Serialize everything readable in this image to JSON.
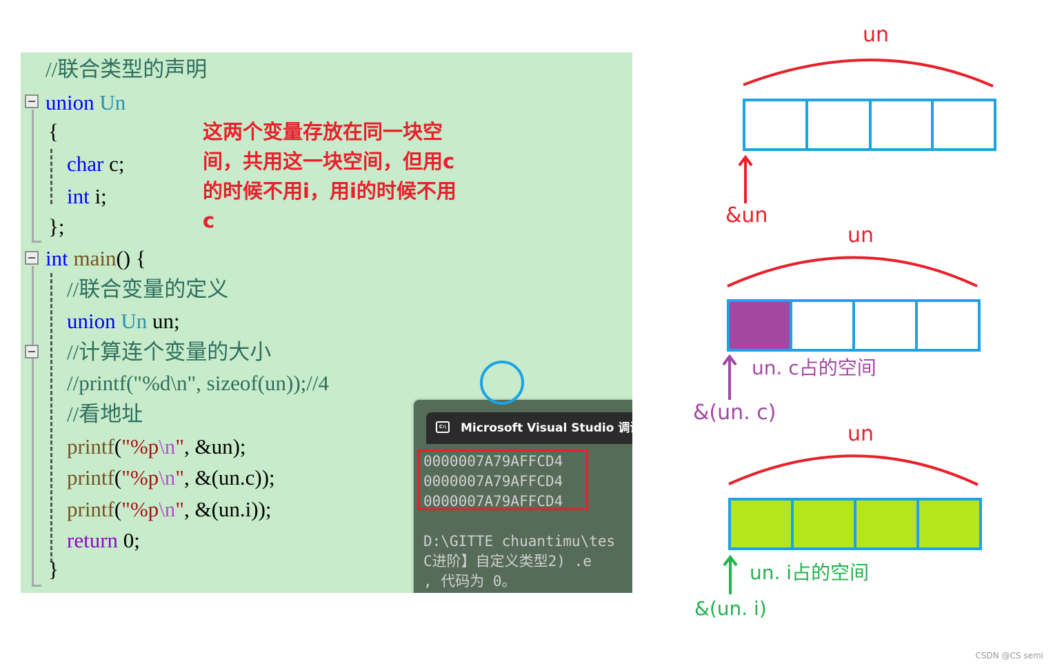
{
  "code": {
    "lines": [
      [
        {
          "k": "comment",
          "t": "//联合类型的声明"
        }
      ],
      [
        {
          "k": "kw",
          "t": "union"
        },
        {
          "k": "plain",
          "t": " "
        },
        {
          "k": "type",
          "t": "Un"
        }
      ],
      [
        {
          "k": "plain",
          "t": "{"
        }
      ],
      [
        {
          "k": "plain",
          "t": "    "
        },
        {
          "k": "kw",
          "t": "char"
        },
        {
          "k": "plain",
          "t": " c;"
        }
      ],
      [
        {
          "k": "plain",
          "t": "    "
        },
        {
          "k": "kw",
          "t": "int"
        },
        {
          "k": "plain",
          "t": " i;"
        }
      ],
      [
        {
          "k": "plain",
          "t": "};"
        }
      ],
      [
        {
          "k": "kw",
          "t": "int"
        },
        {
          "k": "plain",
          "t": " "
        },
        {
          "k": "fn",
          "t": "main"
        },
        {
          "k": "plain",
          "t": "() {"
        }
      ],
      [
        {
          "k": "plain",
          "t": "    "
        },
        {
          "k": "comment",
          "t": "//联合变量的定义"
        }
      ],
      [
        {
          "k": "plain",
          "t": "    "
        },
        {
          "k": "kw",
          "t": "union"
        },
        {
          "k": "plain",
          "t": " "
        },
        {
          "k": "type",
          "t": "Un"
        },
        {
          "k": "plain",
          "t": " un;"
        }
      ],
      [
        {
          "k": "plain",
          "t": "    "
        },
        {
          "k": "comment",
          "t": "//计算连个变量的大小"
        }
      ],
      [
        {
          "k": "plain",
          "t": "    "
        },
        {
          "k": "comment",
          "t": "//printf(\"%d\\n\", sizeof(un));//4"
        }
      ],
      [
        {
          "k": "plain",
          "t": "    "
        },
        {
          "k": "comment",
          "t": "//看地址"
        }
      ],
      [
        {
          "k": "plain",
          "t": "    "
        },
        {
          "k": "fn",
          "t": "printf"
        },
        {
          "k": "plain",
          "t": "("
        },
        {
          "k": "str",
          "t": "\"%p"
        },
        {
          "k": "esc",
          "t": "\\n"
        },
        {
          "k": "str",
          "t": "\""
        },
        {
          "k": "plain",
          "t": ", &un);"
        }
      ],
      [
        {
          "k": "plain",
          "t": "    "
        },
        {
          "k": "fn",
          "t": "printf"
        },
        {
          "k": "plain",
          "t": "("
        },
        {
          "k": "str",
          "t": "\"%p"
        },
        {
          "k": "esc",
          "t": "\\n"
        },
        {
          "k": "str",
          "t": "\""
        },
        {
          "k": "plain",
          "t": ", &(un.c));"
        }
      ],
      [
        {
          "k": "plain",
          "t": "    "
        },
        {
          "k": "fn",
          "t": "printf"
        },
        {
          "k": "plain",
          "t": "("
        },
        {
          "k": "str",
          "t": "\"%p"
        },
        {
          "k": "esc",
          "t": "\\n"
        },
        {
          "k": "str",
          "t": "\""
        },
        {
          "k": "plain",
          "t": ", &(un.i));"
        }
      ],
      [
        {
          "k": "plain",
          "t": "    "
        },
        {
          "k": "ret",
          "t": "return"
        },
        {
          "k": "plain",
          "t": " 0;"
        }
      ],
      [
        {
          "k": "plain",
          "t": "}"
        }
      ]
    ]
  },
  "note": "这两个变量存放在同一块空间，共用这一块空间，但用c的时候不用i，用i的时候不用c",
  "console": {
    "title": "Microsoft Visual Studio 调试控制台",
    "icon": "console-icon",
    "addresses": [
      "0000007A79AFFCD4",
      "0000007A79AFFCD4",
      "0000007A79AFFCD4"
    ],
    "tail": [
      "D:\\GITTE chuantimu\\tes",
      "C进阶】自定义类型2) .e",
      ", 代码为 0。"
    ]
  },
  "diagram": {
    "colors": {
      "red": "#e8202a",
      "blue": "#1aa3e8",
      "purple": "#a347a3",
      "lime": "#b5e61d",
      "green": "#22b14c"
    },
    "d1": {
      "title": "un",
      "pointer": "&un"
    },
    "d2": {
      "title": "un",
      "label": "un. c占的空间",
      "pointer": "&(un. c)"
    },
    "d3": {
      "title": "un",
      "label": "un. i占的空间",
      "pointer": "&(un. i)"
    }
  },
  "watermark": "CSDN @CS semi"
}
